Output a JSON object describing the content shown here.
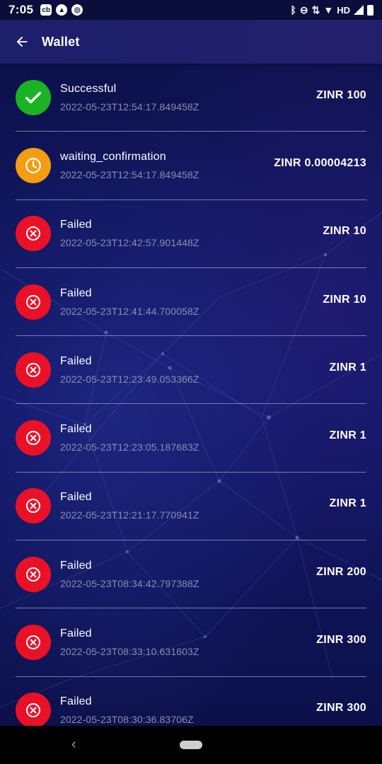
{
  "status_bar": {
    "time": "7:05",
    "left_icons": [
      "app-notification-icon",
      "app-notification-icon",
      "app-notification-icon"
    ],
    "network_label": "HD",
    "right_icons": [
      "bluetooth-icon",
      "do-not-disturb-icon",
      "data-arrows-icon",
      "wifi-icon",
      "signal-icon",
      "battery-icon"
    ]
  },
  "app_bar": {
    "title": "Wallet",
    "back_icon": "arrow-back-icon"
  },
  "colors": {
    "success": "#19b324",
    "pending": "#f49c12",
    "failed": "#ea1127",
    "background": "#0e1250",
    "app_bar": "#1e1f6b",
    "timestamp": "#8a8fae"
  },
  "transactions": [
    {
      "status": "Successful",
      "timestamp": "2022-05-23T12:54:17.849458Z",
      "amount": "ZINR 100",
      "icon": "check-icon"
    },
    {
      "status": "waiting_confirmation",
      "timestamp": "2022-05-23T12:54:17.849458Z",
      "amount": "ZINR 0.00004213",
      "icon": "clock-icon"
    },
    {
      "status": "Failed",
      "timestamp": "2022-05-23T12:42:57.901448Z",
      "amount": "ZINR 10",
      "icon": "close-circle-icon"
    },
    {
      "status": "Failed",
      "timestamp": "2022-05-23T12:41:44.700058Z",
      "amount": "ZINR 10",
      "icon": "close-circle-icon"
    },
    {
      "status": "Failed",
      "timestamp": "2022-05-23T12:23:49.053366Z",
      "amount": "ZINR 1",
      "icon": "close-circle-icon"
    },
    {
      "status": "Failed",
      "timestamp": "2022-05-23T12:23:05.187683Z",
      "amount": "ZINR 1",
      "icon": "close-circle-icon"
    },
    {
      "status": "Failed",
      "timestamp": "2022-05-23T12:21:17.770941Z",
      "amount": "ZINR 1",
      "icon": "close-circle-icon"
    },
    {
      "status": "Failed",
      "timestamp": "2022-05-23T08:34:42.797388Z",
      "amount": "ZINR 200",
      "icon": "close-circle-icon"
    },
    {
      "status": "Failed",
      "timestamp": "2022-05-23T08:33:10.631603Z",
      "amount": "ZINR 300",
      "icon": "close-circle-icon"
    },
    {
      "status": "Failed",
      "timestamp": "2022-05-23T08:30:36.83706Z",
      "amount": "ZINR 300",
      "icon": "close-circle-icon"
    }
  ],
  "nav_bar": {
    "back_glyph": "‹"
  }
}
